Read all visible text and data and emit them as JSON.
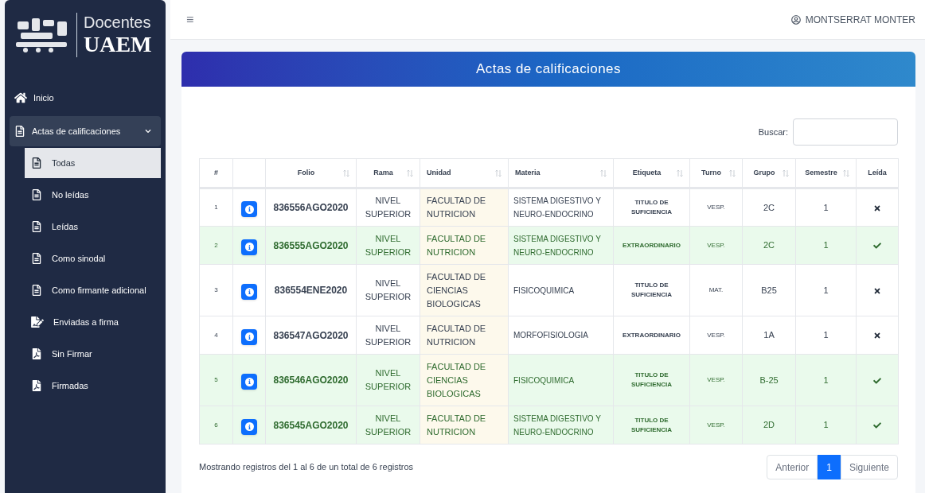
{
  "brand": {
    "line1": "Docentes",
    "line2": "UAEM"
  },
  "sidebar": {
    "items": [
      {
        "label": "Inicio",
        "selected": false
      },
      {
        "label": "Actas de calificaciones",
        "selected": false,
        "expanded": true,
        "children": [
          {
            "label": "Todas",
            "selected": true
          },
          {
            "label": "No leídas",
            "selected": false
          },
          {
            "label": "Leídas",
            "selected": false
          },
          {
            "label": "Como sinodal",
            "selected": false
          },
          {
            "label": "Como firmante adicional",
            "selected": false
          },
          {
            "label": "Enviadas a firma",
            "selected": false
          },
          {
            "label": "Sin Firmar",
            "selected": false
          },
          {
            "label": "Firmadas",
            "selected": false
          }
        ]
      }
    ]
  },
  "topbar": {
    "menu_glyph": "≡",
    "user": "MONTSERRAT MONTER"
  },
  "card": {
    "title": "Actas de calificaciones",
    "search": {
      "label": "Buscar:"
    },
    "table": {
      "columns": [
        {
          "label": "#",
          "sortable": false
        },
        {
          "sortable": false
        },
        {
          "label": "Folio",
          "sortable": true
        },
        {
          "label": "Rama",
          "sortable": true
        },
        {
          "label": "Unidad",
          "sortable": true
        },
        {
          "label": "Materia",
          "sortable": true
        },
        {
          "label": "Etiqueta",
          "sortable": true
        },
        {
          "label": "Turno",
          "sortable": true
        },
        {
          "label": "Grupo",
          "sortable": true
        },
        {
          "label": "Semestre",
          "sortable": true
        },
        {
          "label": "Leída",
          "sortable": false
        }
      ],
      "rows": [
        {
          "n": "1",
          "folio": "836556AGO2020",
          "rama": "NIVEL SUPERIOR",
          "unidad": "FACULTAD DE NUTRICION",
          "materia": "SISTEMA DIGESTIVO Y NEURO-ENDOCRINO",
          "etiqueta": "TITULO DE SUFICIENCIA",
          "turno": "VESP.",
          "grupo": "2C",
          "semestre": "1",
          "read": false
        },
        {
          "n": "2",
          "folio": "836555AGO2020",
          "rama": "NIVEL SUPERIOR",
          "unidad": "FACULTAD DE NUTRICION",
          "materia": "SISTEMA DIGESTIVO Y NEURO-ENDOCRINO",
          "etiqueta": "EXTRAORDINARIO",
          "turno": "VESP.",
          "grupo": "2C",
          "semestre": "1",
          "read": true
        },
        {
          "n": "3",
          "folio": "836554ENE2020",
          "rama": "NIVEL SUPERIOR",
          "unidad": "FACULTAD DE CIENCIAS BIOLOGICAS",
          "materia": "FISICOQUIMICA",
          "etiqueta": "TITULO DE SUFICIENCIA",
          "turno": "MAT.",
          "grupo": "B25",
          "semestre": "1",
          "read": false
        },
        {
          "n": "4",
          "folio": "836547AGO2020",
          "rama": "NIVEL SUPERIOR",
          "unidad": "FACULTAD DE NUTRICION",
          "materia": "MORFOFISIOLOGIA",
          "etiqueta": "EXTRAORDINARIO",
          "turno": "VESP.",
          "grupo": "1A",
          "semestre": "1",
          "read": false
        },
        {
          "n": "5",
          "folio": "836546AGO2020",
          "rama": "NIVEL SUPERIOR",
          "unidad": "FACULTAD DE CIENCIAS BIOLOGICAS",
          "materia": "FISICOQUIMICA",
          "etiqueta": "TITULO DE SUFICIENCIA",
          "turno": "VESP.",
          "grupo": "B-25",
          "semestre": "1",
          "read": true
        },
        {
          "n": "6",
          "folio": "836545AGO2020",
          "rama": "NIVEL SUPERIOR",
          "unidad": "FACULTAD DE NUTRICION",
          "materia": "SISTEMA DIGESTIVO Y NEURO-ENDOCRINO",
          "etiqueta": "TITULO DE SUFICIENCIA",
          "turno": "VESP.",
          "grupo": "2D",
          "semestre": "1",
          "read": true
        }
      ]
    },
    "footer": "Mostrando registros del 1 al 6 de un total de 6 registros",
    "pagination": [
      {
        "label": "Anterior",
        "selected": false
      },
      {
        "label": "1",
        "selected": true
      },
      {
        "label": "Siguiente",
        "selected": false
      }
    ]
  }
}
